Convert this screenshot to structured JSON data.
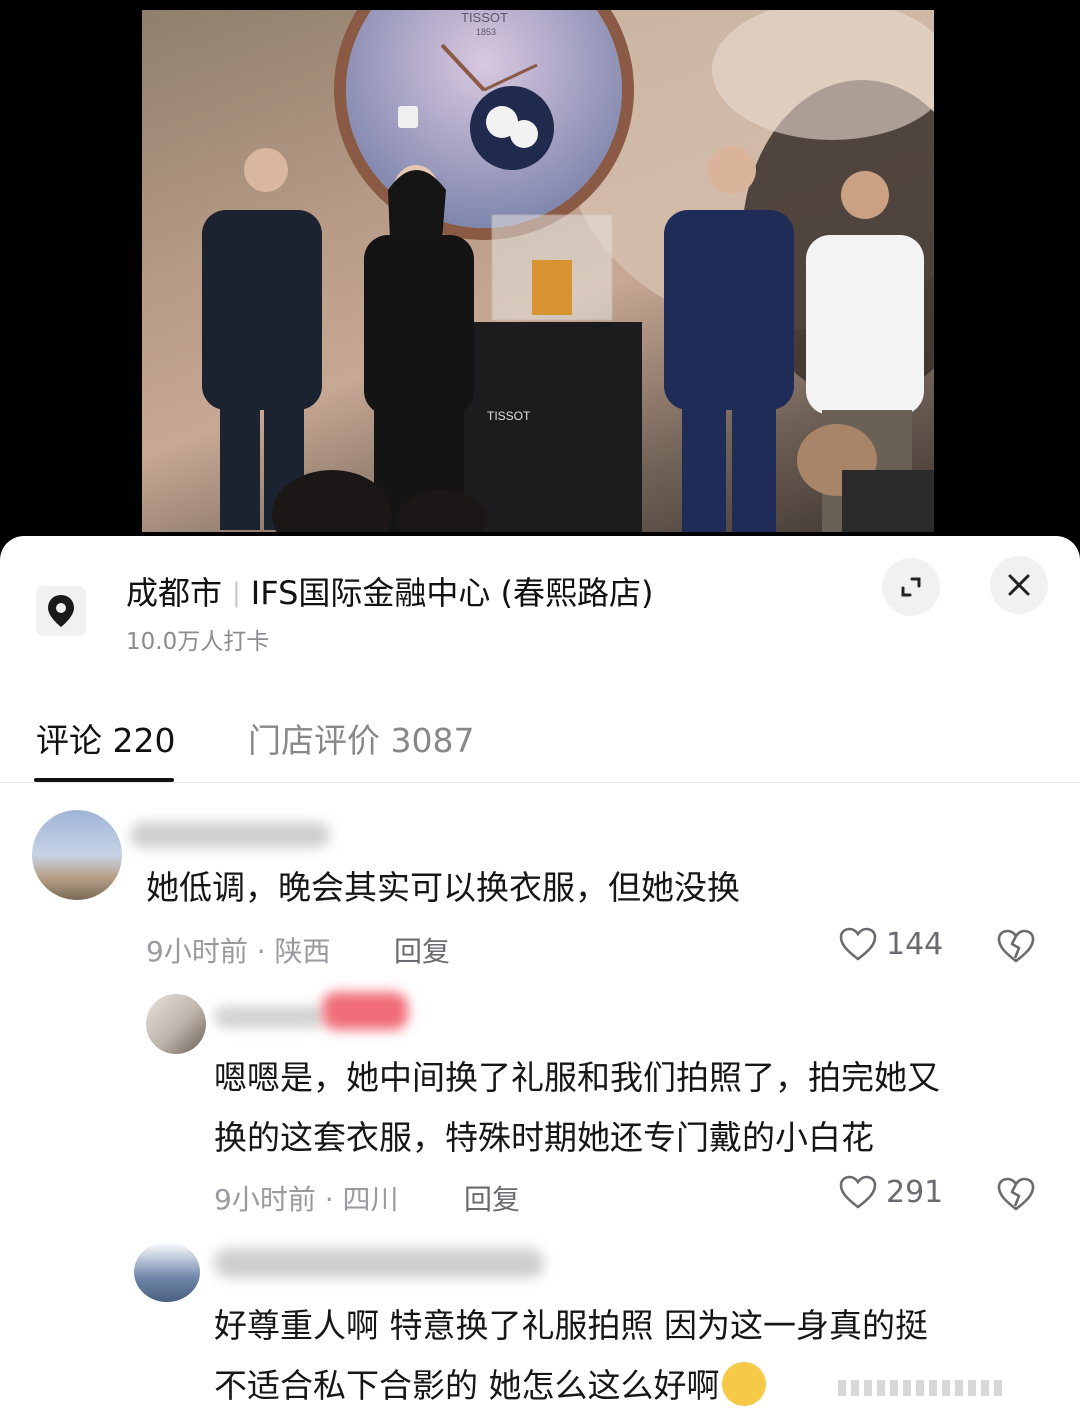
{
  "location": {
    "city": "成都市",
    "place": "IFS国际金融中心 (春熙路店)",
    "checkins": "10.0万人打卡"
  },
  "tabs": {
    "comments": "评论 220",
    "reviews": "门店评价 3087"
  },
  "photo": {
    "brand_text": "TISSOT",
    "year_text": "1853"
  },
  "comments": [
    {
      "text": "她低调，晚会其实可以换衣服，但她没换",
      "meta": "9小时前 · 陕西",
      "reply": "回复",
      "likes": "144"
    },
    {
      "lines": [
        "嗯嗯是，她中间换了礼服和我们拍照了，拍完她又",
        "换的这套衣服，特殊时期她还专门戴的小白花"
      ],
      "meta": "9小时前 · 四川",
      "reply": "回复",
      "likes": "291"
    },
    {
      "lines": [
        "好尊重人啊  特意换了礼服拍照  因为这一身真的挺",
        "不适合私下合影的  她怎么这么好啊"
      ]
    }
  ],
  "colors": {
    "sheet_bg": "#ffffff",
    "text": "#161616",
    "meta": "#9a9aa0"
  }
}
